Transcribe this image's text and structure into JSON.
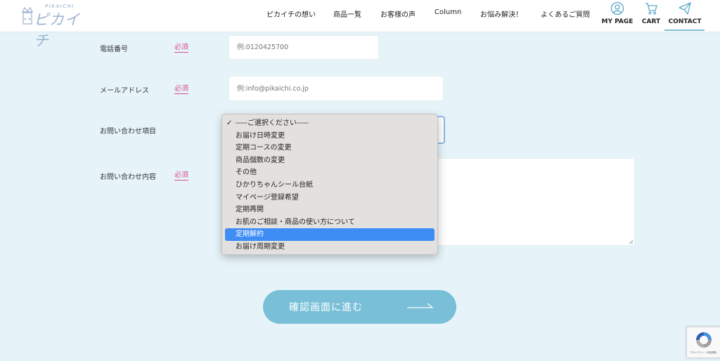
{
  "header": {
    "logo_sub": "PIKAICHI",
    "logo_main": "ピカイチ",
    "nav": [
      "ピカイチの想い",
      "商品一覧",
      "お客様の声",
      "Column",
      "お悩み解決！",
      "よくあるご質問"
    ],
    "icon_nav": {
      "mypage": "MY PAGE",
      "cart": "CART",
      "contact": "CONTACT"
    },
    "icons": {
      "mypage": "user-circle-icon",
      "cart": "shopping-cart-icon",
      "contact": "paper-plane-icon"
    }
  },
  "form": {
    "required_label": "必須",
    "phone": {
      "label": "電話番号",
      "placeholder": "例:0120425700"
    },
    "email": {
      "label": "メールアドレス",
      "placeholder": "例:info@pikaichi.co.jp"
    },
    "inquiry_type": {
      "label": "お問い合わせ項目",
      "selected": "-----ご選択ください-----",
      "options": [
        "-----ご選択ください-----",
        "お届け日時変更",
        "定期コースの変更",
        "商品個数の変更",
        "その他",
        "ひかりちゃんシール台紙",
        "マイページ登録希望",
        "定期再開",
        "お肌のご相談・商品の使い方について",
        "定期解約",
        "お届け周期変更"
      ],
      "highlighted": "定期解約"
    },
    "message": {
      "label": "お問い合わせ内容"
    },
    "submit_label": "確認画面に進む"
  },
  "recaptcha": {
    "text": "プライバシー・利用規約"
  },
  "colors": {
    "background": "#e6f4fa",
    "accent": "#79bfd8",
    "required": "#d9508a",
    "highlight": "#3e8df5"
  }
}
